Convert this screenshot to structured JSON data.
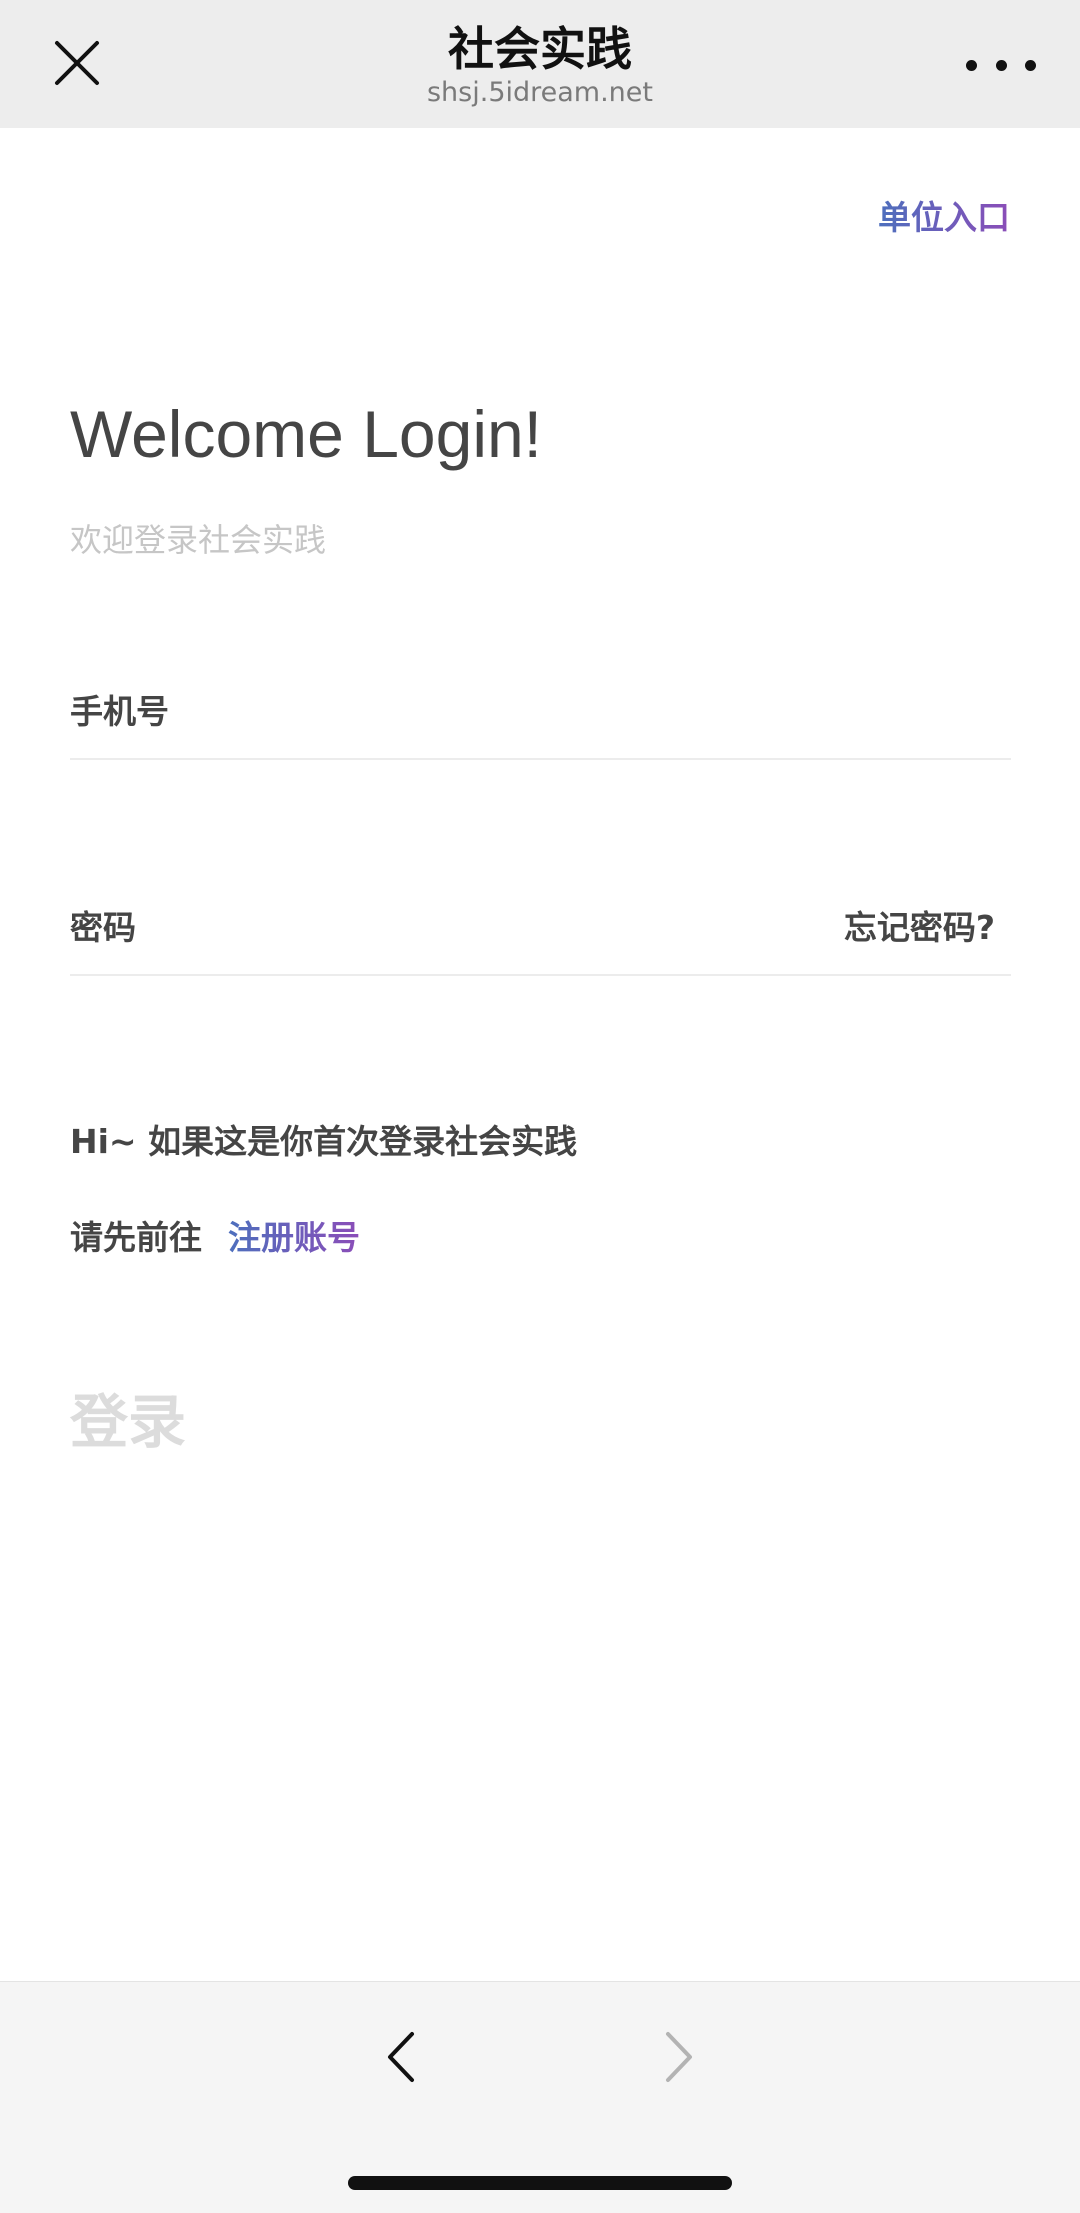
{
  "header": {
    "title": "社会实践",
    "url": "shsj.5idream.net",
    "close_icon": "close-icon",
    "more_icon": "more-icon"
  },
  "main": {
    "unit_entry_label": "单位入口",
    "welcome_title": "Welcome Login!",
    "welcome_subtitle": "欢迎登录社会实践",
    "phone_label": "手机号",
    "phone_value": "",
    "password_label": "密码",
    "password_value": "",
    "forgot_password_label": "忘记密码?",
    "hint_line1": "Hi~ 如果这是你首次登录社会实践",
    "hint_line2": "请先前往",
    "register_label": "注册账号",
    "login_button_label": "登录"
  },
  "bottom_bar": {
    "back_icon": "chevron-left-icon",
    "forward_icon": "chevron-right-icon"
  },
  "colors": {
    "link_gradient_start": "#4d6fbd",
    "link_gradient_end": "#8b4db8",
    "login_disabled": "#dcdcdc",
    "header_bg": "#ededed"
  }
}
